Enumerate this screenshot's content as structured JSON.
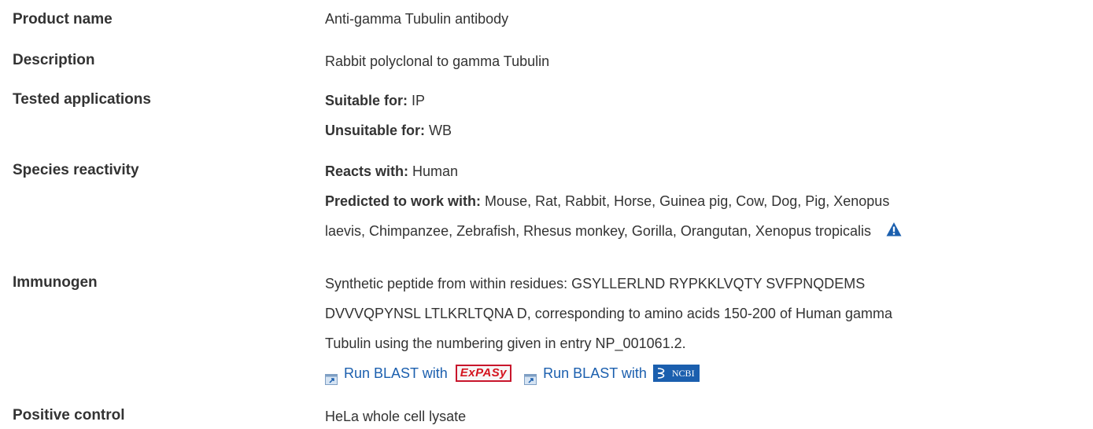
{
  "rows": {
    "product_name": {
      "label": "Product name",
      "value": "Anti-gamma Tubulin antibody"
    },
    "description": {
      "label": "Description",
      "value": "Rabbit polyclonal to gamma Tubulin"
    },
    "tested_applications": {
      "label": "Tested applications",
      "suitable_label": "Suitable for:",
      "suitable_value": "IP",
      "unsuitable_label": "Unsuitable for:",
      "unsuitable_value": "WB"
    },
    "species_reactivity": {
      "label": "Species reactivity",
      "reacts_label": "Reacts with:",
      "reacts_value": "Human",
      "predicted_label": "Predicted to work with:",
      "predicted_line1": "Mouse, Rat, Rabbit, Horse, Guinea pig, Cow, Dog, Pig, Xenopus",
      "predicted_line2": "laevis, Chimpanzee, Zebrafish, Rhesus monkey, Gorilla, Orangutan, Xenopus tropicalis"
    },
    "immunogen": {
      "label": "Immunogen",
      "line1": "Synthetic peptide from within residues: GSYLLERLND RYPKKLVQTY SVFPNQDEMS",
      "line2": "DVVVQPYNSL LTLKRLTQNA D, corresponding to amino acids 150-200 of Human gamma",
      "line3": "Tubulin using the numbering given in entry NP_001061.2.",
      "blast_expasy_label": "Run BLAST with",
      "expasy_logo_text": "ExPASy",
      "blast_ncbi_label": "Run BLAST with",
      "ncbi_logo_text": "NCBI"
    },
    "positive_control": {
      "label": "Positive control",
      "value": "HeLa whole cell lysate"
    }
  },
  "icons": {
    "warning": "warning-triangle-icon",
    "external_link": "external-link-icon"
  },
  "colors": {
    "text": "#333333",
    "link": "#1b5fae",
    "warning": "#1b5fae",
    "expasy_red": "#d4141f",
    "ncbi_blue": "#1b5fae"
  }
}
